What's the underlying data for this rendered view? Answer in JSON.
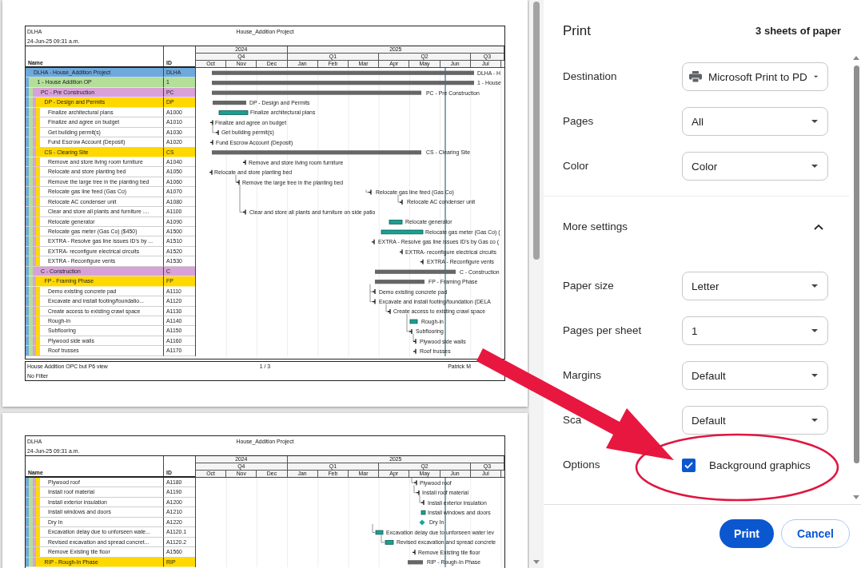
{
  "preview": {
    "pages": [
      {
        "header": {
          "project_code": "DLHA",
          "printed": "24-Jun-25 09:31 a.m.",
          "title": "House_Addition Project"
        },
        "columns": [
          "Name",
          "ID"
        ],
        "timeline": [
          {
            "label": "2024",
            "quarters": [
              {
                "label": "Q4",
                "months": [
                  "Oct",
                  "Nov",
                  "Dec"
                ]
              }
            ]
          },
          {
            "label": "2025",
            "quarters": [
              {
                "label": "Q1",
                "months": [
                  "Jan",
                  "Feb",
                  "Mar"
                ]
              },
              {
                "label": "Q2",
                "months": [
                  "Apr",
                  "May",
                  "Jun"
                ]
              },
              {
                "label": "Q3",
                "months": [
                  "Jul"
                ]
              }
            ]
          }
        ],
        "rows": [
          {
            "name": "DLHA - House_Addition Project",
            "id": "DLHA",
            "bar": {
              "kind": "summary",
              "label": "DLHA - H"
            },
            "children": [
              {
                "name": "1 - House Addition OP",
                "id": "1",
                "bar": {
                  "kind": "summary",
                  "label": "1 - House"
                },
                "children": [
                  {
                    "name": "PC - Pre Construction",
                    "id": "PC",
                    "bar": {
                      "kind": "summary",
                      "label": "PC - Pre Construction"
                    },
                    "children": [
                      {
                        "name": "DP - Design and Permits",
                        "id": "DP",
                        "bar": {
                          "kind": "summary",
                          "label": "DP - Design and Permits"
                        },
                        "children": [
                          {
                            "name": "Finalize architectural plans",
                            "id": "A1000",
                            "bar": {
                              "kind": "task",
                              "label": "Finalize architectural plans"
                            }
                          },
                          {
                            "name": "Finalize and agree on budget",
                            "id": "A1010",
                            "bar": {
                              "kind": "tick",
                              "label": "Finalize and agree on budget"
                            }
                          },
                          {
                            "name": "Get building permit(s)",
                            "id": "A1030",
                            "bar": {
                              "kind": "tick",
                              "label": "Get building permit(s)"
                            }
                          },
                          {
                            "name": "Fund Escrow Account (Deposit)",
                            "id": "A1020",
                            "bar": {
                              "kind": "tick",
                              "label": "Fund Escrow Account (Deposit)"
                            }
                          }
                        ]
                      },
                      {
                        "name": "CS - Clearing Site",
                        "id": "CS",
                        "bar": {
                          "kind": "summary",
                          "label": "CS - Clearing Site"
                        },
                        "children": [
                          {
                            "name": "Remove and store living room furniture",
                            "id": "A1040",
                            "bar": {
                              "kind": "tick",
                              "label": "Remove and store living room furniture"
                            }
                          },
                          {
                            "name": "Relocate and store planting bed",
                            "id": "A1050",
                            "bar": {
                              "kind": "tick",
                              "label": "Relocate and store planting bed"
                            }
                          },
                          {
                            "name": "Remove the large tree in the planting bed",
                            "id": "A1060",
                            "bar": {
                              "kind": "tick",
                              "label": "Remove the large tree in the planting bed"
                            }
                          },
                          {
                            "name": "Relocate gas line feed (Gas Co)",
                            "id": "A1070",
                            "bar": {
                              "kind": "tick",
                              "label": "Relocate gas line feed (Gas Co)"
                            }
                          },
                          {
                            "name": "Relocate AC condenser unit",
                            "id": "A1080",
                            "bar": {
                              "kind": "tick",
                              "label": "Relocate AC condenser unit"
                            }
                          },
                          {
                            "name": "Clear and store all plants and furniture ....",
                            "id": "A1100",
                            "bar": {
                              "kind": "tick",
                              "label": "Clear and store all plants and furniture on side patio"
                            }
                          },
                          {
                            "name": "Relocate generator",
                            "id": "A1090",
                            "bar": {
                              "kind": "task",
                              "label": "Relocate generator"
                            }
                          },
                          {
                            "name": "Relocate gas meter (Gas Co) ($450)",
                            "id": "A1500",
                            "bar": {
                              "kind": "task",
                              "label": "Relocate gas meter (Gas Co) ("
                            }
                          },
                          {
                            "name": "EXTRA - Resolve gas line issues ID's by ...",
                            "id": "A1510",
                            "bar": {
                              "kind": "tick",
                              "label": "EXTRA - Resolve gas line issues ID's by Gas co ("
                            }
                          },
                          {
                            "name": "EXTRA- reconfigure electrical circuits",
                            "id": "A1520",
                            "bar": {
                              "kind": "tick",
                              "label": "EXTRA- reconfigure electrical circuits"
                            }
                          },
                          {
                            "name": "EXTRA - Reconfigure vents",
                            "id": "A1530",
                            "bar": {
                              "kind": "tick",
                              "label": "EXTRA - Reconfigure vents"
                            }
                          }
                        ]
                      }
                    ]
                  },
                  {
                    "name": "C - Construction",
                    "id": "C",
                    "bar": {
                      "kind": "summary",
                      "label": "C - Construction"
                    },
                    "children": [
                      {
                        "name": "FP - Framing Phase",
                        "id": "FP",
                        "bar": {
                          "kind": "summary",
                          "label": "FP - Framing Phase"
                        },
                        "children": [
                          {
                            "name": "Demo existing concrete pad",
                            "id": "A1110",
                            "bar": {
                              "kind": "tick",
                              "label": "Demo existing concrete pad"
                            }
                          },
                          {
                            "name": "Excavate and install footing/foundatio...",
                            "id": "A1120",
                            "bar": {
                              "kind": "tick",
                              "label": "Excavate and install footing/foundation (DELA"
                            }
                          },
                          {
                            "name": "Create access to existing crawl space",
                            "id": "A1130",
                            "bar": {
                              "kind": "tick",
                              "label": "Create access to existing crawl space"
                            }
                          },
                          {
                            "name": "Rough-in",
                            "id": "A1140",
                            "bar": {
                              "kind": "task",
                              "label": "Rough-in"
                            }
                          },
                          {
                            "name": "Subflooring",
                            "id": "A1150",
                            "bar": {
                              "kind": "tick",
                              "label": "Subflooring"
                            }
                          },
                          {
                            "name": "Plywood side walls",
                            "id": "A1160",
                            "bar": {
                              "kind": "tick",
                              "label": "Plywood side walls"
                            }
                          },
                          {
                            "name": "Roof trusses",
                            "id": "A1170",
                            "bar": {
                              "kind": "tick",
                              "label": "Roof trusses"
                            }
                          }
                        ]
                      }
                    ]
                  }
                ]
              }
            ]
          }
        ],
        "footer": {
          "layout": "House Addition OPC but P6 view",
          "filter": "No Filter",
          "page": "1 / 3",
          "author": "Patrick M"
        }
      },
      {
        "header": {
          "project_code": "DLHA",
          "printed": "24-Jun-25 09:31 a.m.",
          "title": "House_Addition Project"
        },
        "columns": [
          "Name",
          "ID"
        ],
        "timeline": [
          {
            "label": "2024",
            "quarters": [
              {
                "label": "Q4",
                "months": [
                  "Oct",
                  "Nov",
                  "Dec"
                ]
              }
            ]
          },
          {
            "label": "2025",
            "quarters": [
              {
                "label": "Q1",
                "months": [
                  "Jan",
                  "Feb",
                  "Mar"
                ]
              },
              {
                "label": "Q2",
                "months": [
                  "Apr",
                  "May",
                  "Jun"
                ]
              },
              {
                "label": "Q3",
                "months": [
                  "Jul"
                ]
              }
            ]
          }
        ],
        "rows": [
          {
            "children": [
              {
                "children": [
                  {
                    "children": [
                      {
                        "children": [
                          {
                            "name": "Plywood roof",
                            "id": "A1180",
                            "bar": {
                              "kind": "tick",
                              "label": "Plywood roof"
                            }
                          },
                          {
                            "name": "Install roof material",
                            "id": "A1190",
                            "bar": {
                              "kind": "tick",
                              "label": "Install roof material"
                            }
                          },
                          {
                            "name": "Install exterior insulation",
                            "id": "A1200",
                            "bar": {
                              "kind": "tick",
                              "label": "Install exterior insulation"
                            }
                          },
                          {
                            "name": "Install windows and doors",
                            "id": "A1210",
                            "bar": {
                              "kind": "task",
                              "label": "Install windows and doors"
                            }
                          },
                          {
                            "name": "Dry In",
                            "id": "A1220",
                            "bar": {
                              "kind": "milestone",
                              "label": "Dry In"
                            }
                          },
                          {
                            "name": "Excavation delay due to unforseen wate...",
                            "id": "A1120.1",
                            "bar": {
                              "kind": "task",
                              "label": "Excavation delay due to unforseen water lev"
                            }
                          },
                          {
                            "name": "Revised excavation and spread concret...",
                            "id": "A1120.2",
                            "bar": {
                              "kind": "task",
                              "label": "Revised excavation and spread concrete"
                            }
                          },
                          {
                            "name": "Remove Existing tile floor",
                            "id": "A1560",
                            "bar": {
                              "kind": "tick",
                              "label": "Remove Existing tile floor"
                            }
                          }
                        ]
                      },
                      {
                        "name": "RIP - Rough-In Phase",
                        "id": "RIP",
                        "bar": {
                          "kind": "summary",
                          "label": "RIP - Rough-In Phase"
                        }
                      }
                    ]
                  }
                ]
              }
            ]
          }
        ]
      }
    ]
  },
  "print_panel": {
    "title": "Print",
    "sheet_count": "3 sheets of paper",
    "settings": [
      {
        "kind": "destination",
        "label": "Destination",
        "value": "Microsoft Print to PD"
      },
      {
        "kind": "select",
        "label": "Pages",
        "value": "All"
      },
      {
        "kind": "select",
        "label": "Color",
        "value": "Color"
      }
    ],
    "more_settings": {
      "label": "More settings",
      "expanded": true,
      "settings": [
        {
          "kind": "select",
          "label": "Paper size",
          "value": "Letter"
        },
        {
          "kind": "select",
          "label": "Pages per sheet",
          "value": "1"
        },
        {
          "kind": "select",
          "label": "Margins",
          "value": "Default"
        },
        {
          "kind": "select",
          "label": "Sca",
          "value": "Default"
        },
        {
          "kind": "checkbox",
          "label": "Options",
          "option": "Background graphics",
          "checked": true
        }
      ]
    },
    "buttons": [
      {
        "kind": "primary",
        "label": "Print"
      },
      {
        "kind": "secondary",
        "label": "Cancel"
      }
    ]
  }
}
